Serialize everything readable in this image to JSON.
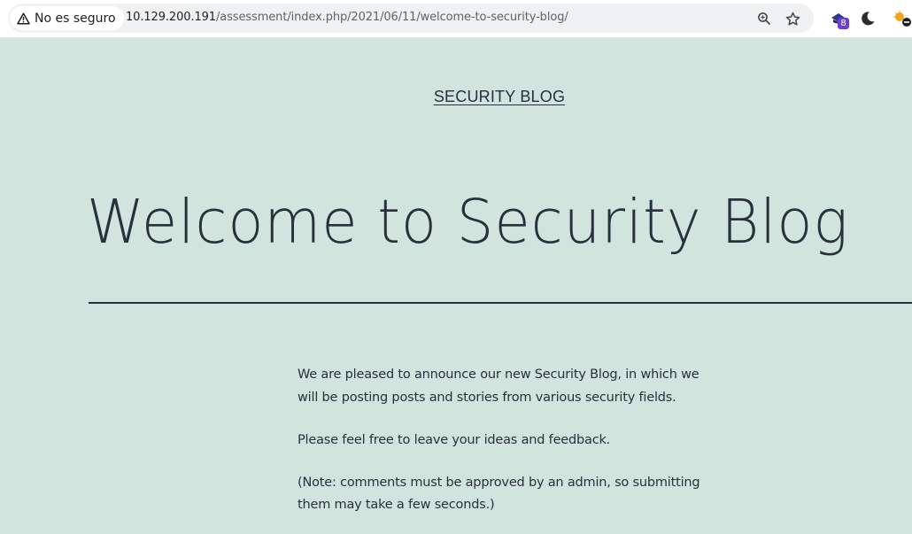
{
  "browser": {
    "security_label": "No es seguro",
    "url_host": "10.129.200.191",
    "url_path": "/assessment/index.php/2021/06/11/welcome-to-security-blog/",
    "icons": [
      "warning-icon",
      "zoom-icon",
      "bookmark-star-icon",
      "extension-icon",
      "dark-mode-icon",
      "extension-icon"
    ],
    "extension_badge": "8"
  },
  "page": {
    "background": "#d1e4dd",
    "text_color": "#28303d",
    "site_title": "SECURITY BLOG",
    "post_title": "Welcome to Security Blog",
    "paragraphs": [
      "We are pleased to announce our new Security Blog, in which we will be posting posts and stories from various security fields.",
      "Please feel free to leave your ideas and feedback.",
      "(Note: comments must be approved by an admin, so submitting them may take a few seconds.)"
    ]
  }
}
